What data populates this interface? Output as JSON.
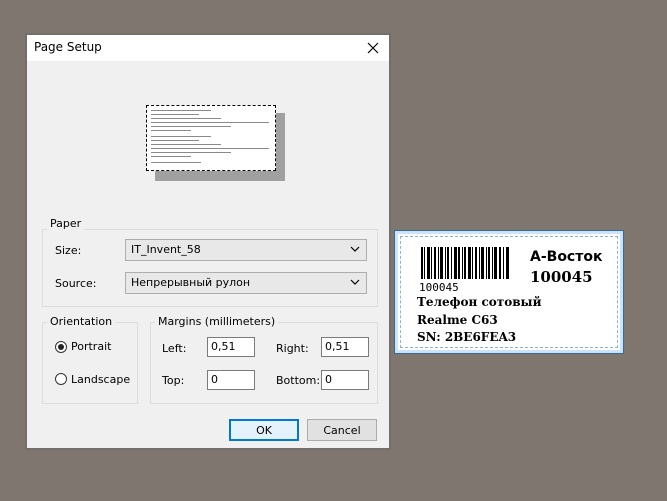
{
  "dialog": {
    "title": "Page Setup",
    "paper": {
      "group_label": "Paper",
      "size_label": "Size:",
      "size_value": "IT_Invent_58",
      "source_label": "Source:",
      "source_value": "Непрерывный рулон"
    },
    "orientation": {
      "group_label": "Orientation",
      "portrait": "Portrait",
      "landscape": "Landscape",
      "selected": "Portrait"
    },
    "margins": {
      "group_label": "Margins (millimeters)",
      "left_label": "Left:",
      "left_value": "0,51",
      "right_label": "Right:",
      "right_value": "0,51",
      "top_label": "Top:",
      "top_value": "0",
      "bottom_label": "Bottom:",
      "bottom_value": "0"
    },
    "ok_label": "OK",
    "cancel_label": "Cancel"
  },
  "label": {
    "barcode_number": "100045",
    "place": "А-Восток",
    "code": "100045",
    "line1": "Телефон сотовый",
    "line2": "Realme C63",
    "line3": "SN:  2BE6FEA3"
  },
  "colors": {
    "desktop": "#7f776f",
    "dialog_bg": "#f0f0f0",
    "accent": "#0078d7",
    "label_border": "#2d6ca8"
  }
}
